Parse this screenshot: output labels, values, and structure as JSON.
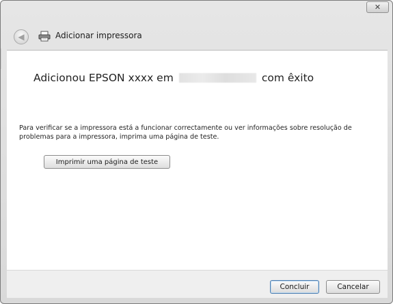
{
  "window": {
    "title": "Adicionar impressora",
    "close_symbol": "✕"
  },
  "nav": {
    "back_symbol": "◀",
    "icon": "printer-icon"
  },
  "main": {
    "heading_prefix": "Adicionou EPSON xxxx em",
    "heading_suffix": "com êxito",
    "description": "Para verificar se a impressora está a funcionar correctamente ou ver informações sobre resolução de problemas para a impressora, imprima uma página de teste.",
    "test_button_label": "Imprimir uma página de teste"
  },
  "footer": {
    "finish_label": "Concluir",
    "cancel_label": "Cancelar"
  }
}
